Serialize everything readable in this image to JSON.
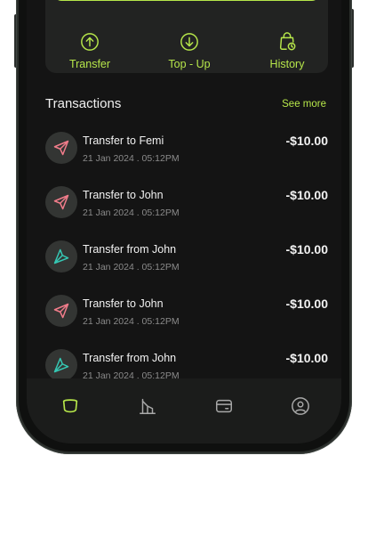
{
  "colors": {
    "accent": "#b6e64a",
    "outgoing_icon": "#f07c8a",
    "incoming_icon": "#35c8b4",
    "background": "#141414"
  },
  "quick_actions": [
    {
      "label": "Transfer",
      "icon": "arrow-up-circle-icon"
    },
    {
      "label": "Top - Up",
      "icon": "arrow-down-circle-icon"
    },
    {
      "label": "History",
      "icon": "bag-clock-icon"
    }
  ],
  "transactions_section": {
    "title": "Transactions",
    "see_more": "See more",
    "items": [
      {
        "name": "Transfer to Femi",
        "date": "21 Jan 2024 . 05:12PM",
        "amount": "-$10.00",
        "direction": "outgoing"
      },
      {
        "name": "Transfer to John",
        "date": "21 Jan 2024 . 05:12PM",
        "amount": "-$10.00",
        "direction": "outgoing"
      },
      {
        "name": "Transfer from John",
        "date": "21 Jan 2024 . 05:12PM",
        "amount": "-$10.00",
        "direction": "incoming"
      },
      {
        "name": "Transfer to John",
        "date": "21 Jan 2024 . 05:12PM",
        "amount": "-$10.00",
        "direction": "outgoing"
      },
      {
        "name": "Transfer from John",
        "date": "21 Jan 2024 . 05:12PM",
        "amount": "-$10.00",
        "direction": "incoming"
      }
    ]
  },
  "bottom_nav": [
    {
      "icon": "home-icon",
      "active": true
    },
    {
      "icon": "stats-icon",
      "active": false
    },
    {
      "icon": "card-icon",
      "active": false
    },
    {
      "icon": "profile-icon",
      "active": false
    }
  ]
}
